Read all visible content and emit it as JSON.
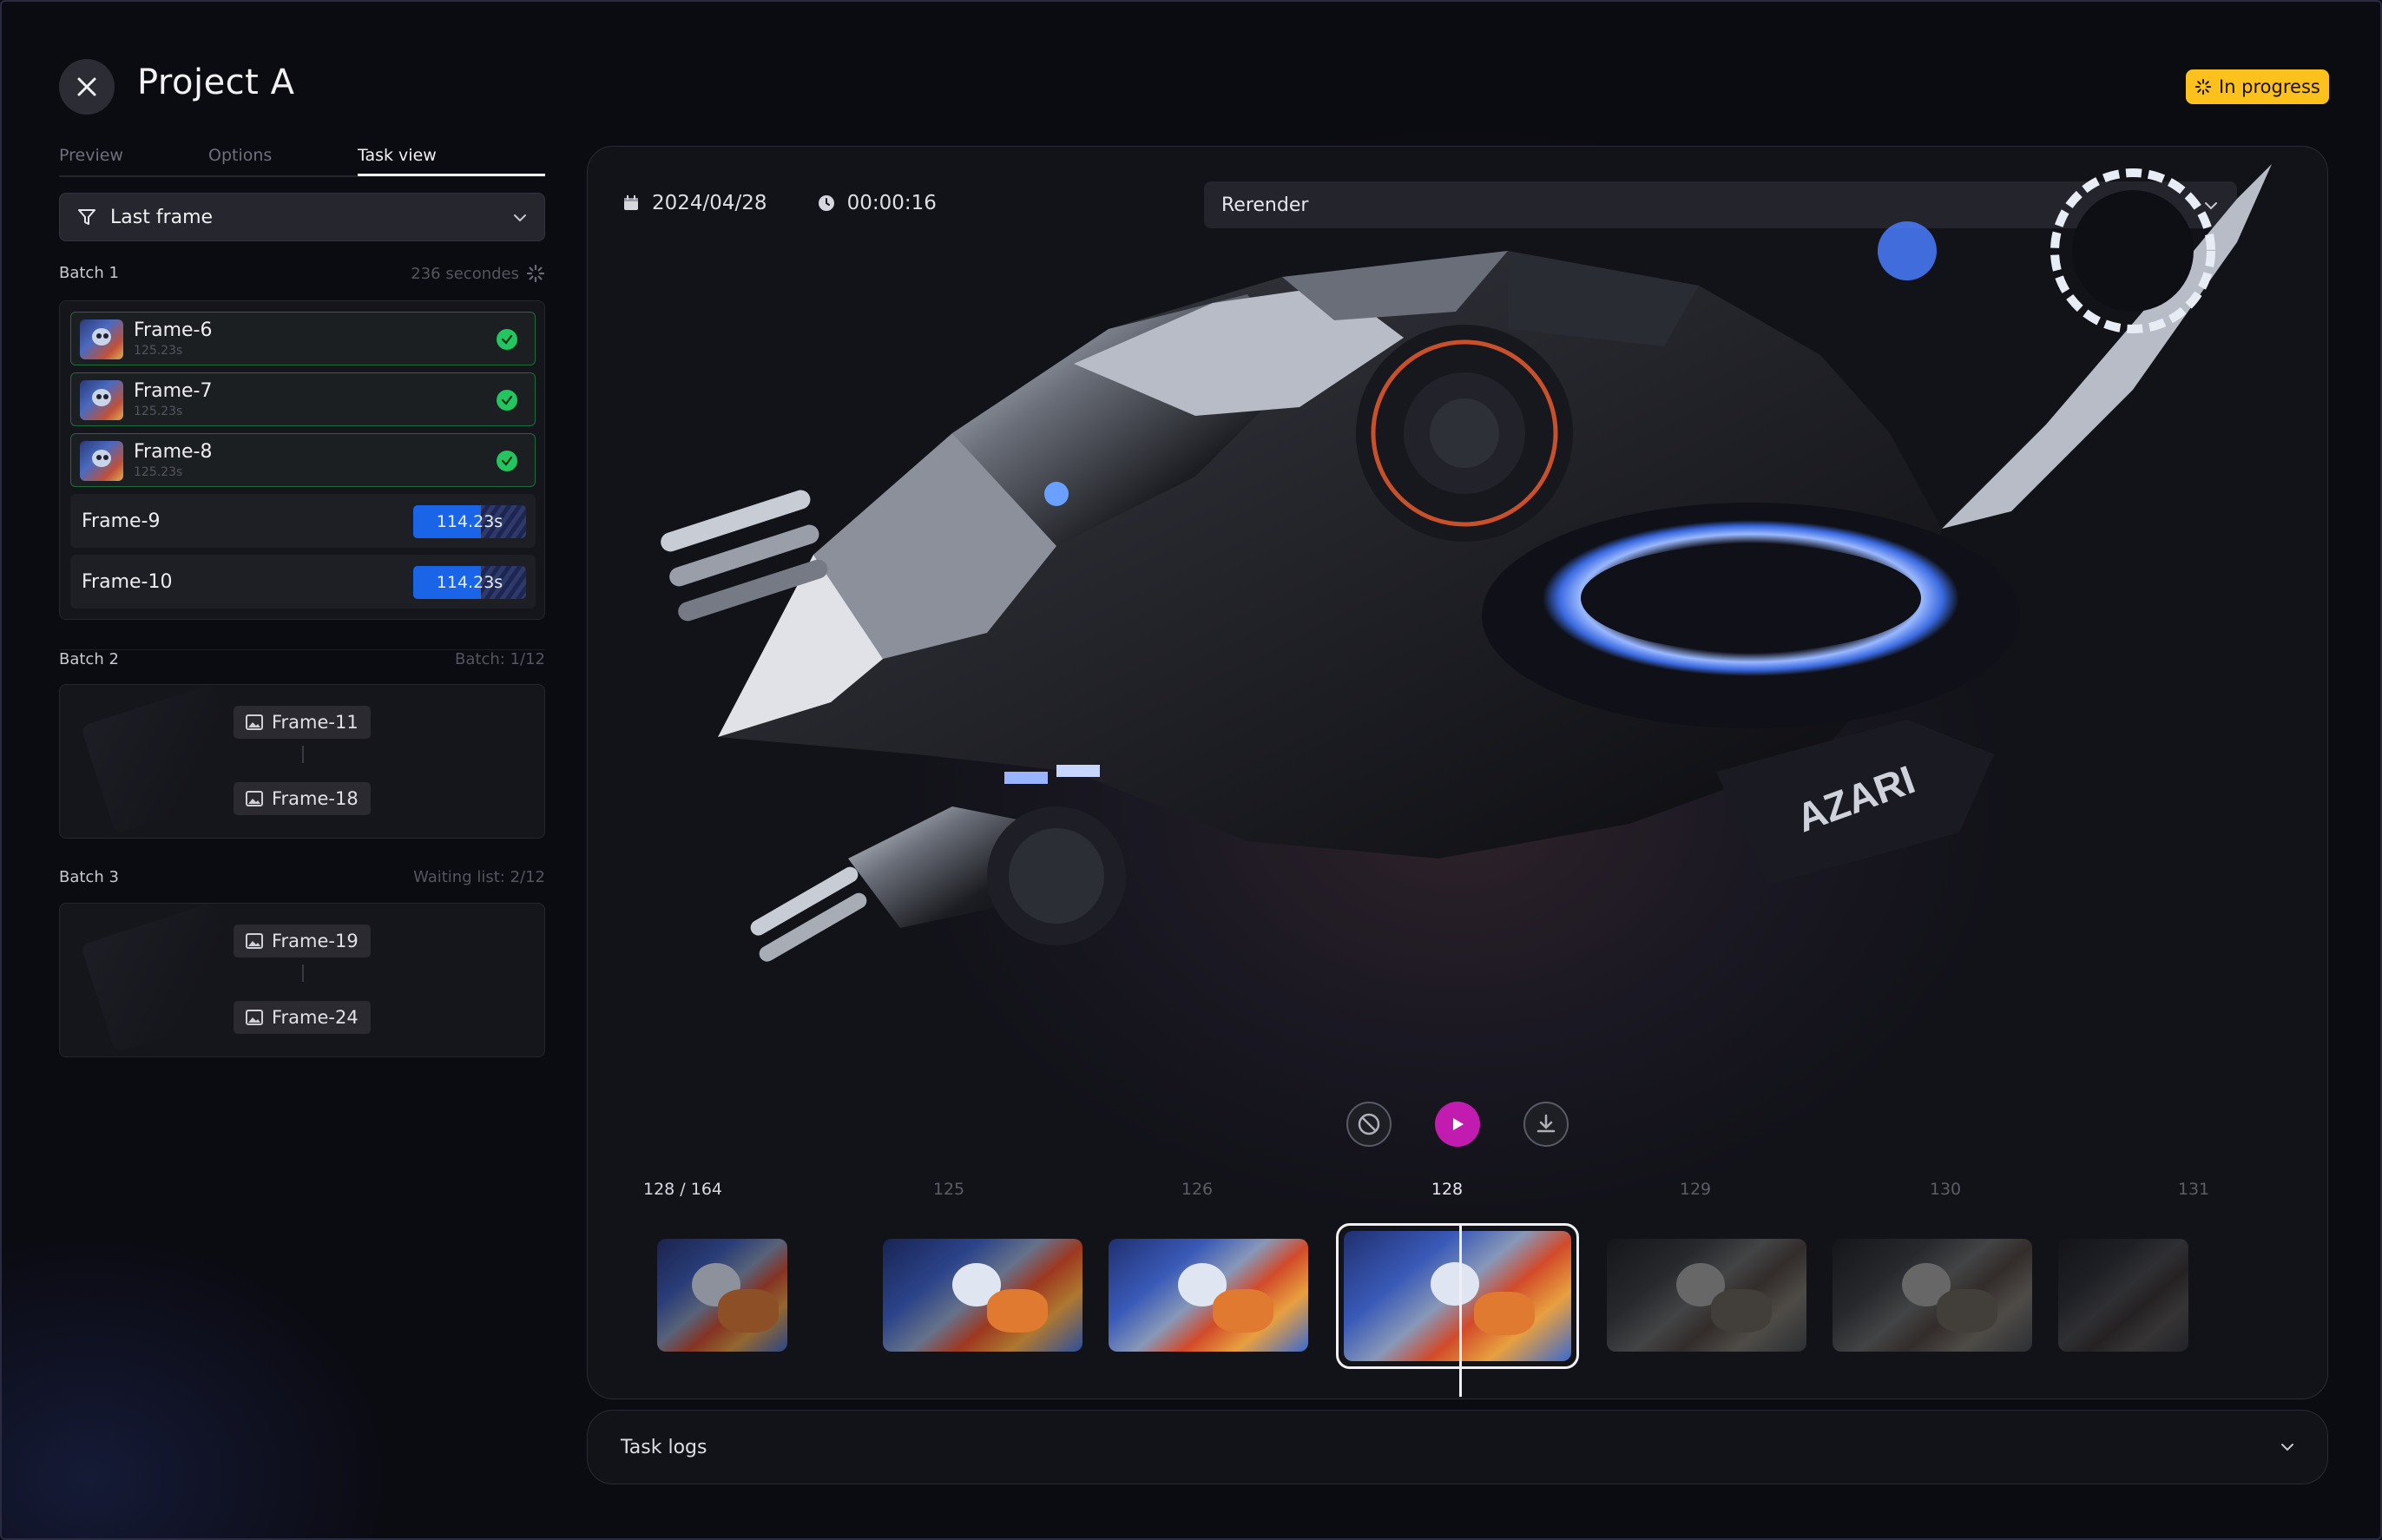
{
  "header": {
    "title": "Project A",
    "status": "In progress"
  },
  "tabs": [
    {
      "label": "Preview"
    },
    {
      "label": "Options"
    },
    {
      "label": "Task view"
    }
  ],
  "filter": {
    "label": "Last frame"
  },
  "batches": [
    {
      "title": "Batch 1",
      "info": "236 secondes",
      "frames": [
        {
          "name": "Frame-6",
          "time": "125.23s",
          "status": "done"
        },
        {
          "name": "Frame-7",
          "time": "125.23s",
          "status": "done"
        },
        {
          "name": "Frame-8",
          "time": "125.23s",
          "status": "done"
        },
        {
          "name": "Frame-9",
          "progress_label": "114.23s",
          "progress": 0.6,
          "status": "rendering"
        },
        {
          "name": "Frame-10",
          "progress_label": "114.23s",
          "progress": 0.6,
          "status": "rendering"
        }
      ]
    },
    {
      "title": "Batch 2",
      "info": "Batch: 1/12",
      "range": {
        "start": "Frame-11",
        "end": "Frame-18"
      }
    },
    {
      "title": "Batch 3",
      "info": "Waiting list: 2/12",
      "range": {
        "start": "Frame-19",
        "end": "Frame-24"
      }
    }
  ],
  "viewer": {
    "date": "2024/04/28",
    "duration": "00:00:16",
    "rerender_label": "Rerender",
    "counter": "128 / 164",
    "ticks": [
      "125",
      "126",
      "128",
      "129",
      "130",
      "131"
    ],
    "active_tick": "128"
  },
  "logs": {
    "label": "Task logs"
  },
  "colors": {
    "accent_play": "#c21bb0",
    "progress": "#1a64e8",
    "success": "#22c55e",
    "status_badge": "#fcc11c"
  }
}
